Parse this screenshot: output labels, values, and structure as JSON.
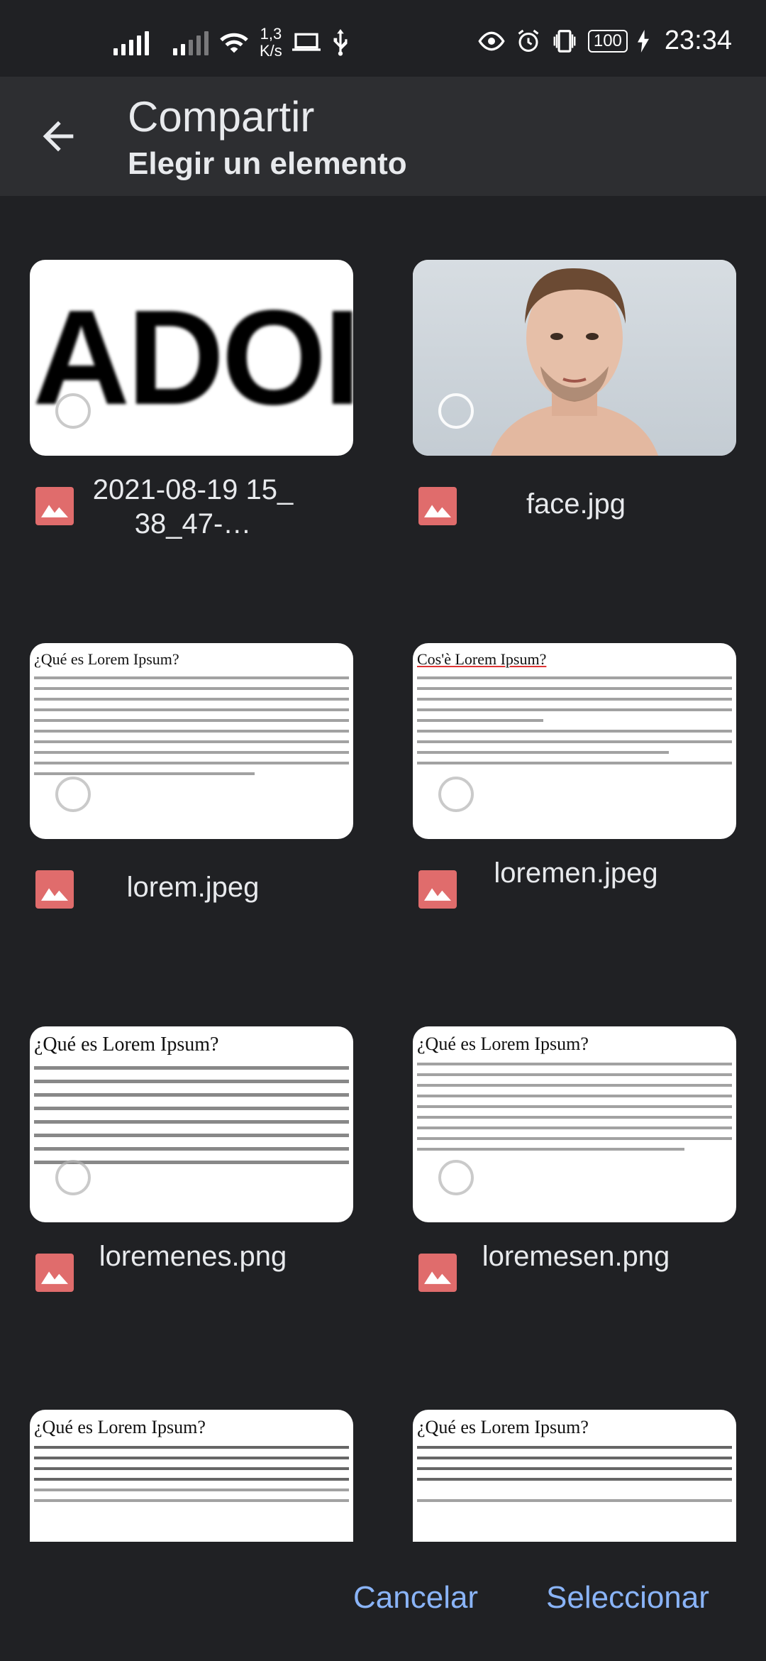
{
  "status_bar": {
    "speed_value": "1,3",
    "speed_unit": "K/s",
    "battery": "100",
    "time": "23:34"
  },
  "app_bar": {
    "title": "Compartir",
    "subtitle": "Elegir un elemento"
  },
  "files": [
    {
      "name": "2021-08-19 15_38_47-…",
      "thumb": "blur-text",
      "thumb_text": "ADOI"
    },
    {
      "name": "face.jpg",
      "thumb": "photo"
    },
    {
      "name": "lorem.jpeg",
      "thumb": "document",
      "thumb_title": "¿Qué es Lorem Ipsum?"
    },
    {
      "name": "loremen.jpeg",
      "thumb": "document",
      "thumb_title": "Cos'è Lorem Ipsum?"
    },
    {
      "name": "loremenes.png",
      "thumb": "document",
      "thumb_title": "¿Qué es Lorem Ipsum?"
    },
    {
      "name": "loremesen.png",
      "thumb": "document",
      "thumb_title": "¿Qué es Lorem Ipsum?"
    },
    {
      "name": "",
      "thumb": "document",
      "thumb_title": "¿Qué es Lorem Ipsum?"
    },
    {
      "name": "",
      "thumb": "document",
      "thumb_title": "¿Qué es Lorem Ipsum?"
    }
  ],
  "actions": {
    "cancel": "Cancelar",
    "select": "Seleccionar"
  },
  "colors": {
    "background": "#202124",
    "app_bar": "#2d2e31",
    "accent": "#8ab4f8",
    "file_icon": "#e06c6c"
  }
}
